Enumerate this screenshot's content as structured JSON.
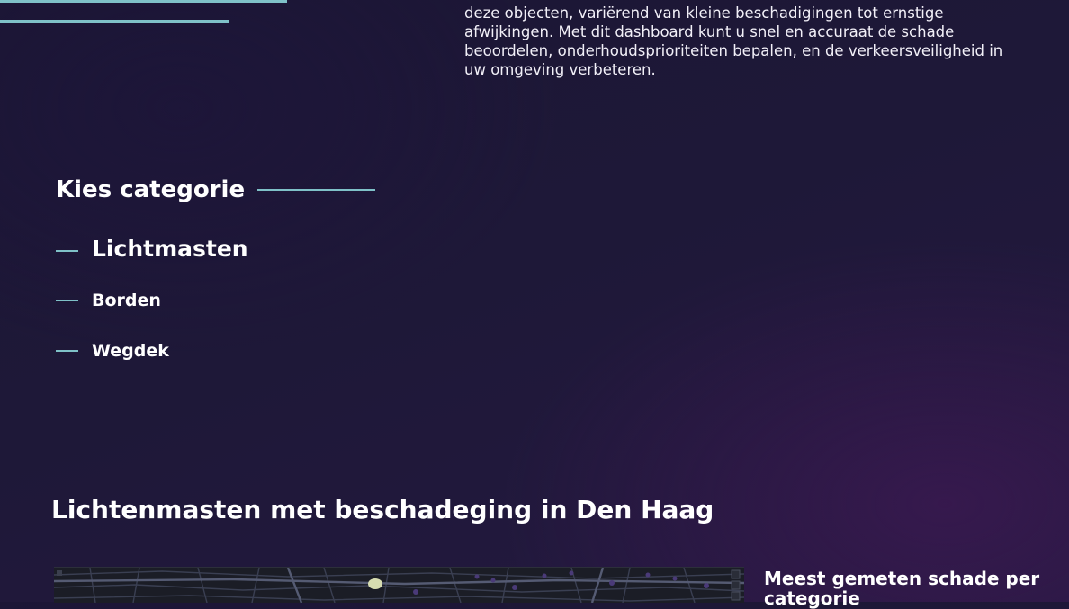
{
  "intro": {
    "lines": [
      "deze objecten, variërend van kleine beschadigingen tot ernstige",
      "afwijkingen. Met dit dashboard  kunt u snel en accuraat de schade",
      "beoordelen, onderhoudsprioriteiten bepalen, en de verkeersveiligheid in",
      "uw omgeving verbeteren."
    ]
  },
  "category_selector": {
    "heading": "Kies categorie",
    "items": [
      {
        "label": "Lichtmasten",
        "selected": true
      },
      {
        "label": "Borden",
        "selected": false
      },
      {
        "label": "Wegdek",
        "selected": false
      }
    ]
  },
  "section": {
    "title": "Lichtenmasten met beschadeging in Den Haag"
  },
  "map": {
    "theme": "dark",
    "marker_color": "#d6dcb0",
    "street_color": "#3a3f52"
  },
  "side_panel": {
    "title": "Meest gemeten schade per categorie"
  },
  "colors": {
    "accent": "#7fc1c8",
    "background": "#1e1838",
    "text": "#ffffff"
  }
}
